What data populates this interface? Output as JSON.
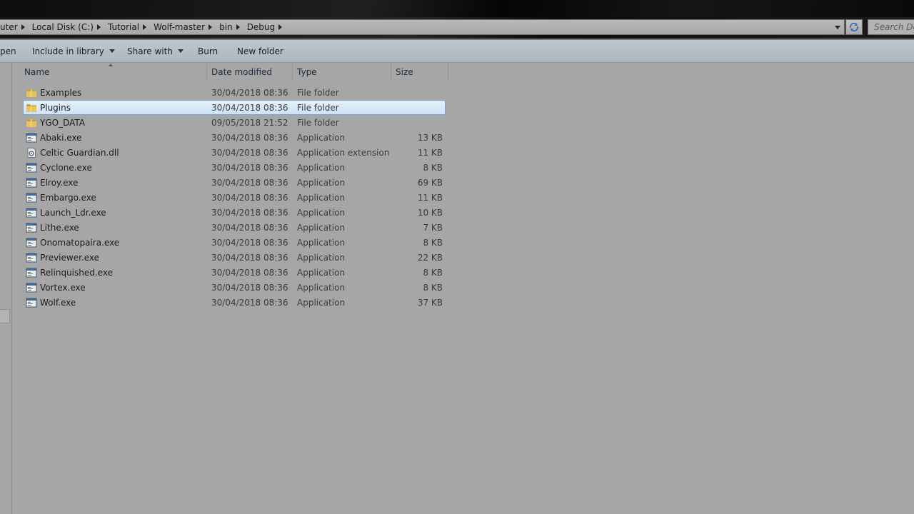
{
  "address_bar": {
    "crumbs": [
      "uter",
      "Local Disk (C:)",
      "Tutorial",
      "Wolf-master",
      "bin",
      "Debug"
    ],
    "search_placeholder": "Search Deb"
  },
  "toolbar": {
    "open_label": "pen",
    "include_in_library_label": "Include in library",
    "share_with_label": "Share with",
    "burn_label": "Burn",
    "new_folder_label": "New folder"
  },
  "columns": {
    "name": "Name",
    "date_modified": "Date modified",
    "type": "Type",
    "size": "Size"
  },
  "files": [
    {
      "name": "Examples",
      "date": "30/04/2018 08:36",
      "type": "File folder",
      "size": "",
      "icon": "folder-icon",
      "selected": false
    },
    {
      "name": "Plugins",
      "date": "30/04/2018 08:36",
      "type": "File folder",
      "size": "",
      "icon": "folder-icon",
      "selected": true
    },
    {
      "name": "YGO_DATA",
      "date": "09/05/2018 21:52",
      "type": "File folder",
      "size": "",
      "icon": "folder-icon",
      "selected": false
    },
    {
      "name": "Abaki.exe",
      "date": "30/04/2018 08:36",
      "type": "Application",
      "size": "13 KB",
      "icon": "application-icon",
      "selected": false
    },
    {
      "name": "Celtic Guardian.dll",
      "date": "30/04/2018 08:36",
      "type": "Application extension",
      "size": "11 KB",
      "icon": "dll-icon",
      "selected": false
    },
    {
      "name": "Cyclone.exe",
      "date": "30/04/2018 08:36",
      "type": "Application",
      "size": "8 KB",
      "icon": "application-icon",
      "selected": false
    },
    {
      "name": "Elroy.exe",
      "date": "30/04/2018 08:36",
      "type": "Application",
      "size": "69 KB",
      "icon": "application-icon",
      "selected": false
    },
    {
      "name": "Embargo.exe",
      "date": "30/04/2018 08:36",
      "type": "Application",
      "size": "11 KB",
      "icon": "application-icon",
      "selected": false
    },
    {
      "name": "Launch_Ldr.exe",
      "date": "30/04/2018 08:36",
      "type": "Application",
      "size": "10 KB",
      "icon": "application-icon",
      "selected": false
    },
    {
      "name": "Lithe.exe",
      "date": "30/04/2018 08:36",
      "type": "Application",
      "size": "7 KB",
      "icon": "application-icon",
      "selected": false
    },
    {
      "name": "Onomatopaira.exe",
      "date": "30/04/2018 08:36",
      "type": "Application",
      "size": "8 KB",
      "icon": "application-icon",
      "selected": false
    },
    {
      "name": "Previewer.exe",
      "date": "30/04/2018 08:36",
      "type": "Application",
      "size": "22 KB",
      "icon": "application-icon",
      "selected": false
    },
    {
      "name": "Relinquished.exe",
      "date": "30/04/2018 08:36",
      "type": "Application",
      "size": "8 KB",
      "icon": "application-icon",
      "selected": false
    },
    {
      "name": "Vortex.exe",
      "date": "30/04/2018 08:36",
      "type": "Application",
      "size": "8 KB",
      "icon": "application-icon",
      "selected": false
    },
    {
      "name": "Wolf.exe",
      "date": "30/04/2018 08:36",
      "type": "Application",
      "size": "37 KB",
      "icon": "application-icon",
      "selected": false
    }
  ],
  "colors": {
    "selection_fill": "#cfe3f7",
    "selection_border": "#7da2ce",
    "folder_yellow": "#e8c25a",
    "background": "#a6a6a6"
  }
}
